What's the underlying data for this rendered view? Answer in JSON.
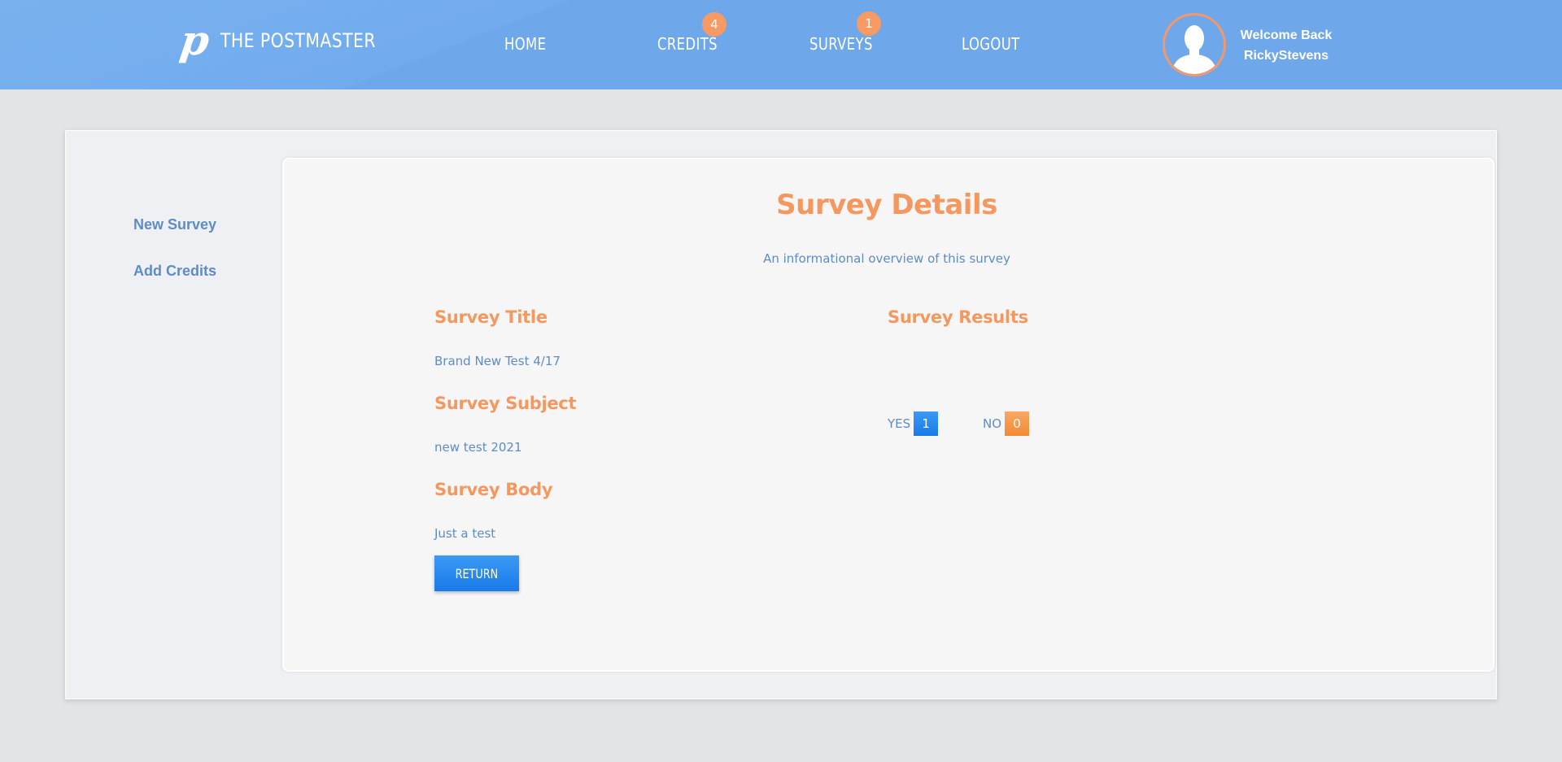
{
  "header": {
    "logo_mark": "p",
    "brand": "THE POSTMASTER",
    "nav": {
      "home": "HOME",
      "credits": "CREDITS",
      "surveys": "SURVEYS",
      "logout": "LOGOUT"
    },
    "badges": {
      "credits": "4",
      "surveys": "1"
    },
    "welcome_line1": "Welcome Back",
    "username": "RickyStevens"
  },
  "sidebar": {
    "items": [
      {
        "label": "New Survey"
      },
      {
        "label": "Add Credits"
      }
    ]
  },
  "main": {
    "title": "Survey Details",
    "subtitle": "An informational overview of this survey",
    "survey_title_label": "Survey Title",
    "survey_title_value": "Brand New Test 4/17",
    "survey_subject_label": "Survey Subject",
    "survey_subject_value": "new test 2021",
    "survey_body_label": "Survey Body",
    "survey_body_value": "Just a test",
    "return_label": "RETURN",
    "results_label": "Survey Results",
    "results": {
      "yes_label": "YES",
      "yes_count": "1",
      "no_label": "NO",
      "no_count": "0"
    }
  },
  "colors": {
    "header_blue": "#6fa8ea",
    "accent_orange": "#f4985f",
    "link_blue": "#5d8cc6",
    "button_blue": "#1a7ae8"
  },
  "icons": {
    "avatar": "user-silhouette-icon"
  }
}
